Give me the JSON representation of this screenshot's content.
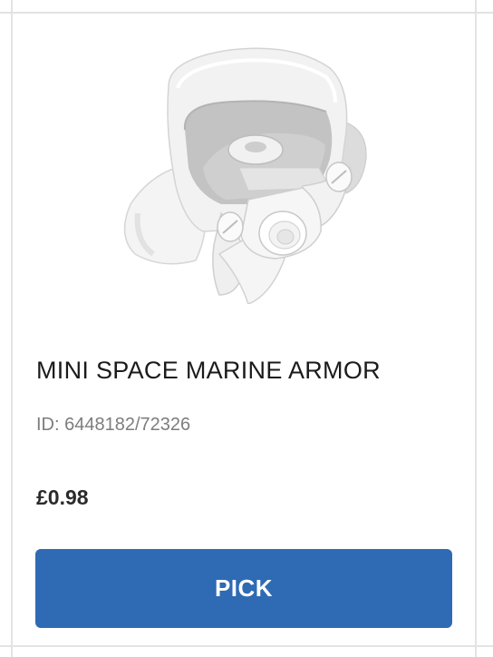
{
  "product": {
    "name": "MINI SPACE MARINE ARMOR",
    "id_text": "ID: 6448182/72326",
    "price": "£0.98",
    "image_icon": "space-marine-armor-image"
  },
  "actions": {
    "pick_label": "PICK"
  },
  "colors": {
    "button": "#2f6ab4",
    "button_text": "#ffffff",
    "id_text": "#7d7d7d",
    "grid_line": "#e3e3e3"
  }
}
